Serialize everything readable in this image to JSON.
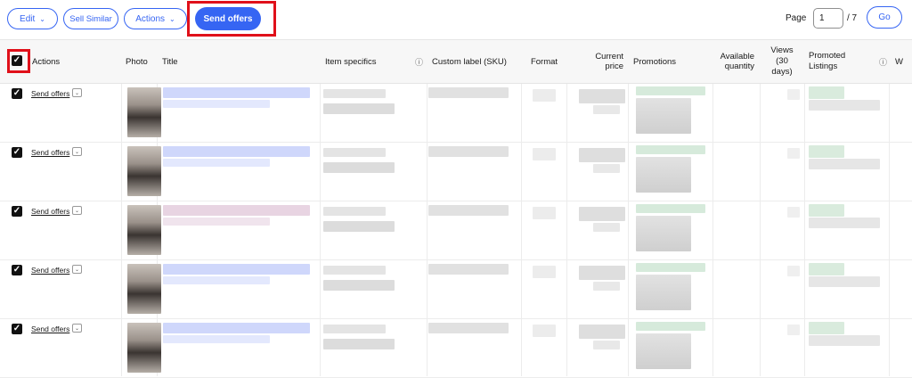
{
  "toolbar": {
    "edit_label": "Edit",
    "sell_similar_label": "Sell Similar",
    "actions_label": "Actions",
    "send_offers_label": "Send offers",
    "chevron": "⌄"
  },
  "pagination": {
    "page_label": "Page",
    "current_page": "1",
    "total_label": "/ 7",
    "go_label": "Go"
  },
  "table": {
    "headers": {
      "actions": "Actions",
      "photo": "Photo",
      "title": "Title",
      "item_specifics": "Item specifics",
      "custom_label": "Custom label (SKU)",
      "format": "Format",
      "current_price": "Current price",
      "promotions": "Promotions",
      "available_quantity": "Available quantity",
      "views": "Views (30 days)",
      "promoted_listings": "Promoted Listings",
      "overflow": "W"
    },
    "info_icon": "ⓘ",
    "check_glyph": "✓",
    "row_action_label": "Send offers",
    "row_chevron": "⌄"
  },
  "colors": {
    "accent": "#3665f3",
    "highlight_border": "#e0101a"
  }
}
